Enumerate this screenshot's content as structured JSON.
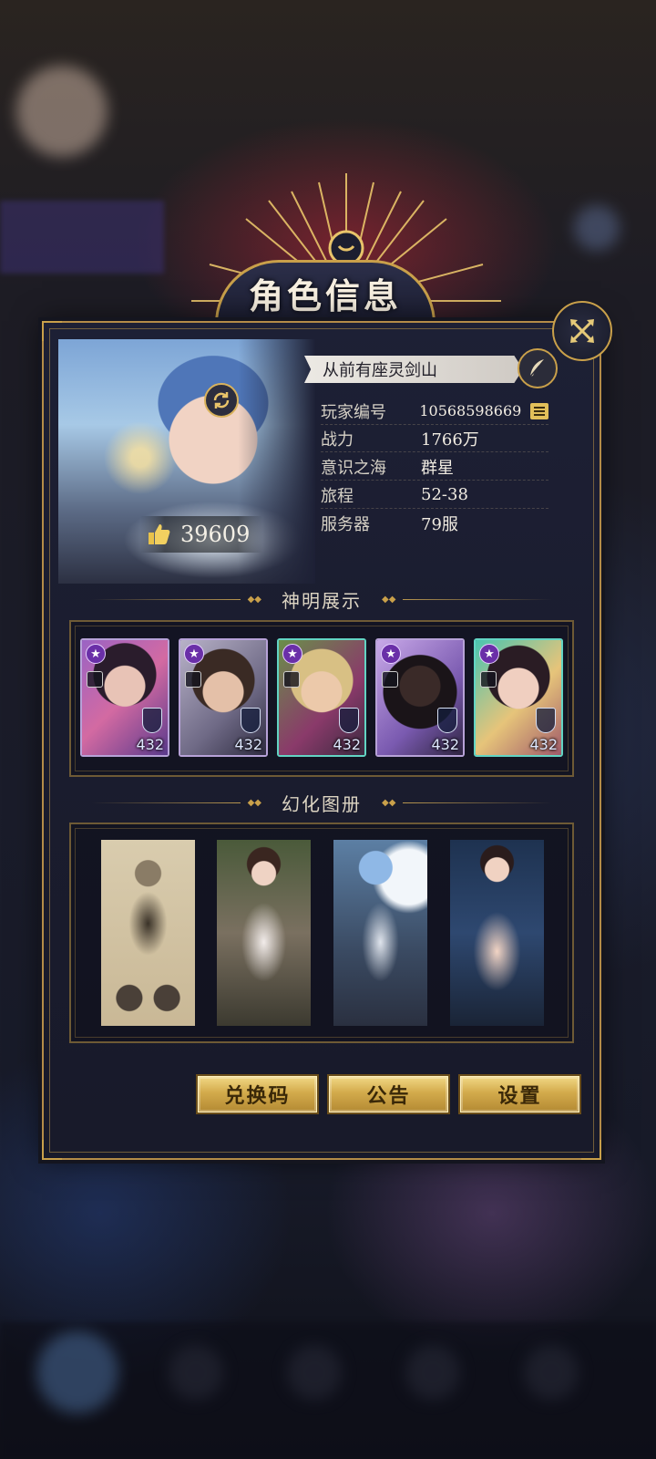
{
  "window": {
    "title": "角色信息"
  },
  "profile": {
    "name": "从前有座灵剑山",
    "likes": "39609",
    "info": [
      {
        "label": "玩家编号",
        "value": "10568598669"
      },
      {
        "label": "战力",
        "value": "1766万"
      },
      {
        "label": "意识之海",
        "value": "群星"
      },
      {
        "label": "旅程",
        "value": "52-38"
      },
      {
        "label": "服务器",
        "value": "79服"
      }
    ]
  },
  "sections": {
    "gods_title": "神明展示",
    "skins_title": "幻化图册"
  },
  "gods": [
    {
      "level": "432"
    },
    {
      "level": "432"
    },
    {
      "level": "432"
    },
    {
      "level": "432"
    },
    {
      "level": "432"
    }
  ],
  "actions": {
    "redeem": "兑换码",
    "notice": "公告",
    "settings": "设置"
  },
  "icons": [
    "close-icon",
    "refresh-icon",
    "thumbs-up-icon",
    "feather-icon",
    "copy-icon",
    "star-icon",
    "shield-icon"
  ],
  "colors": {
    "accent": "#c9a04a",
    "panel": "#1b1d30",
    "button": "#d3ab4c"
  }
}
